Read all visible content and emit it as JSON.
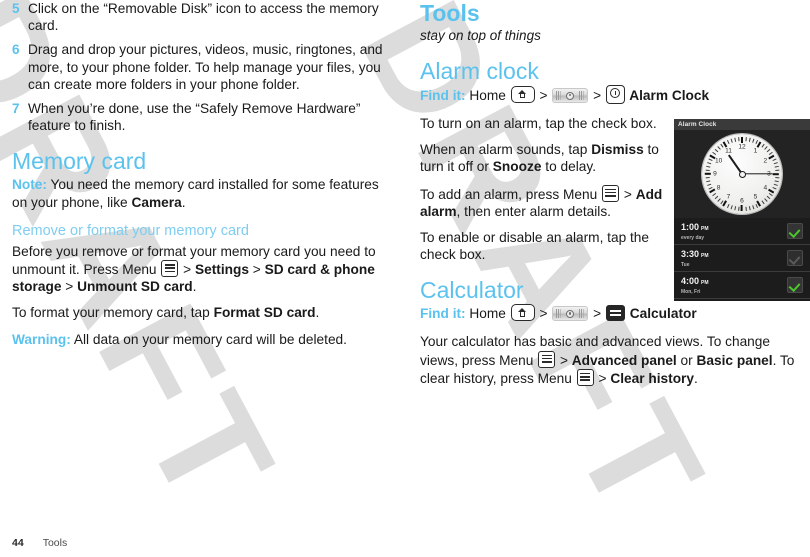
{
  "left_column": {
    "steps": [
      {
        "num": "5",
        "text": "Click on the “Removable Disk” icon to access the memory card."
      },
      {
        "num": "6",
        "text": "Drag and drop your pictures, videos, music, ringtones, and more, to your phone folder. To help manage your files, you can create more folders in your phone folder."
      },
      {
        "num": "7",
        "text": "When you’re done, use the “Safely Remove Hardware” feature to finish."
      }
    ],
    "memory_card": {
      "heading": "Memory card",
      "note_label": "Note:",
      "note_text_1": " You need the memory card installed for some features on your phone, like ",
      "note_bold": "Camera",
      "note_text_2": ".",
      "sub_heading": "Remove or format your memory card",
      "unmount_p1": "Before you remove or format your memory card you need to unmount it. Press Menu ",
      "unmount_gt1": " > ",
      "unmount_b1": "Settings",
      "unmount_gt2": " > ",
      "unmount_b2": "SD card & phone storage",
      "unmount_gt3": " > ",
      "unmount_b3": "Unmount SD card",
      "unmount_end": ".",
      "format_p1": "To format your memory card, tap ",
      "format_b": "Format SD card",
      "format_end": ".",
      "warning_label": "Warning:",
      "warning_text": " All data on your memory card will be deleted."
    }
  },
  "right_column": {
    "chapter_title": "Tools",
    "chapter_tagline": "stay on top of things",
    "alarm": {
      "heading": "Alarm clock",
      "findit_label": "Find it:",
      "findit_home": " Home ",
      "findit_sep1": " > ",
      "findit_sep2": " > ",
      "findit_target": " Alarm Clock",
      "p1": "To turn on an alarm, tap the check box.",
      "p2_a": "When an alarm sounds, tap ",
      "p2_b1": "Dismiss",
      "p2_c": " to turn it off or ",
      "p2_b2": "Snooze",
      "p2_d": " to delay.",
      "p3_a": "To add an alarm, press Menu ",
      "p3_gt": " > ",
      "p3_b": "Add alarm",
      "p3_c": ", then enter alarm details.",
      "p4": "To enable or disable an alarm, tap the check box."
    },
    "calculator": {
      "heading": "Calculator",
      "findit_label": "Find it:",
      "findit_home": " Home ",
      "findit_sep1": " > ",
      "findit_sep2": " > ",
      "findit_target": " Calculator",
      "p1_a": "Your calculator has basic and advanced views. To change views, press Menu ",
      "p1_gt": " > ",
      "p1_b1": "Advanced panel",
      "p1_c": " or ",
      "p1_b2": "Basic panel",
      "p1_d": ". To clear history, press Menu ",
      "p1_gt2": " > ",
      "p1_b3": "Clear history",
      "p1_end": "."
    }
  },
  "phone_screenshot": {
    "title": "Alarm Clock",
    "clock": {
      "hour_label": "11",
      "minute_label": "3"
    },
    "clock_numbers": [
      "12",
      "1",
      "2",
      "3",
      "4",
      "5",
      "6",
      "7",
      "8",
      "9",
      "10",
      "11"
    ],
    "alarms": [
      {
        "time": "1:00",
        "meridiem": "PM",
        "days": "every day",
        "enabled": true
      },
      {
        "time": "3:30",
        "meridiem": "PM",
        "days": "Tue",
        "enabled": false
      },
      {
        "time": "4:00",
        "meridiem": "PM",
        "days": "Mon, Fri",
        "enabled": true
      }
    ]
  },
  "footer": {
    "page_number": "44",
    "chapter": "Tools"
  },
  "watermark": {
    "text": "DRAFT"
  },
  "colors": {
    "accent_blue": "#5bc2ee",
    "sub_blue": "#7fcdf0",
    "check_green": "#4cc72c",
    "text": "#1a1a1a"
  }
}
